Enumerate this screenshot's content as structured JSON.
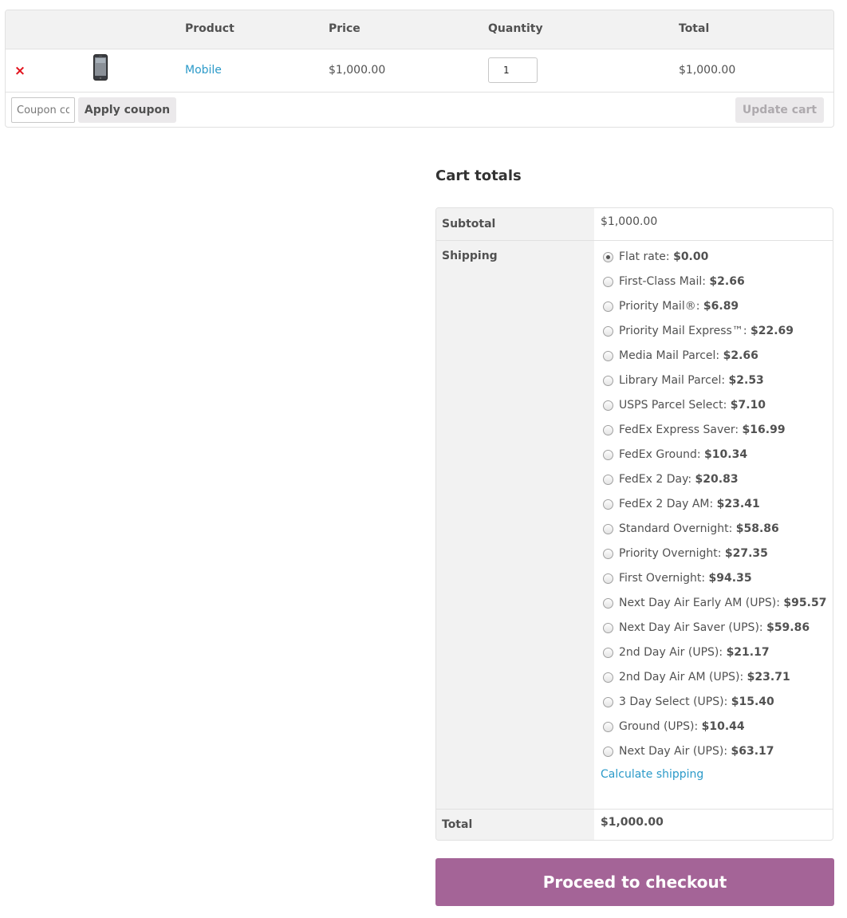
{
  "cart": {
    "columns": {
      "product": "Product",
      "price": "Price",
      "quantity": "Quantity",
      "total": "Total"
    },
    "item": {
      "remove": "×",
      "name": "Mobile",
      "price": "$1,000.00",
      "quantity": "1",
      "total": "$1,000.00"
    },
    "coupon_placeholder": "Coupon code",
    "apply_coupon_label": "Apply coupon",
    "update_cart_label": "Update cart"
  },
  "totals": {
    "title": "Cart totals",
    "subtotal_label": "Subtotal",
    "subtotal_value": "$1,000.00",
    "shipping_label": "Shipping",
    "shipping_options": [
      {
        "name": "Flat rate:",
        "price": "$0.00",
        "selected": true
      },
      {
        "name": "First-Class Mail:",
        "price": "$2.66"
      },
      {
        "name": "Priority Mail®:",
        "price": "$6.89"
      },
      {
        "name": "Priority Mail Express™:",
        "price": "$22.69"
      },
      {
        "name": "Media Mail Parcel:",
        "price": "$2.66"
      },
      {
        "name": "Library Mail Parcel:",
        "price": "$2.53"
      },
      {
        "name": "USPS Parcel Select:",
        "price": "$7.10"
      },
      {
        "name": "FedEx Express Saver:",
        "price": "$16.99"
      },
      {
        "name": "FedEx Ground:",
        "price": "$10.34"
      },
      {
        "name": "FedEx 2 Day:",
        "price": "$20.83"
      },
      {
        "name": "FedEx 2 Day AM:",
        "price": "$23.41"
      },
      {
        "name": "Standard Overnight:",
        "price": "$58.86"
      },
      {
        "name": "Priority Overnight:",
        "price": "$27.35"
      },
      {
        "name": "First Overnight:",
        "price": "$94.35"
      },
      {
        "name": "Next Day Air Early AM (UPS):",
        "price": "$95.57"
      },
      {
        "name": "Next Day Air Saver (UPS):",
        "price": "$59.86"
      },
      {
        "name": "2nd Day Air (UPS):",
        "price": "$21.17"
      },
      {
        "name": "2nd Day Air AM (UPS):",
        "price": "$23.71"
      },
      {
        "name": "3 Day Select (UPS):",
        "price": "$15.40"
      },
      {
        "name": "Ground (UPS):",
        "price": "$10.44"
      },
      {
        "name": "Next Day Air (UPS):",
        "price": "$63.17"
      }
    ],
    "calculate_shipping_label": "Calculate shipping",
    "total_label": "Total",
    "total_value": "$1,000.00"
  },
  "checkout_label": "Proceed to checkout",
  "colors": {
    "accent": "#a46497",
    "link": "#2b9ac9",
    "remove": "#e2131d"
  }
}
